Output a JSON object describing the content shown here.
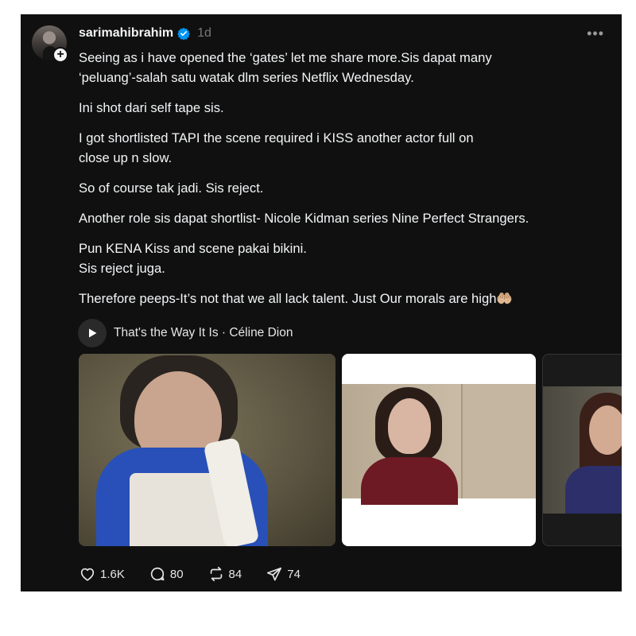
{
  "post": {
    "username": "sarimahibrahim",
    "timestamp": "1d",
    "more_label": "•••",
    "follow_badge": "+",
    "paragraphs": [
      [
        "Seeing as i have opened the ‘gates’ let me share more.Sis dapat many",
        "‘peluang’-salah satu watak dlm series Netflix Wednesday."
      ],
      [
        "Ini shot dari self tape sis."
      ],
      [
        "I got shortlisted TAPI the scene required i KISS another actor full on",
        "close up n slow."
      ],
      [
        "So of course tak jadi. Sis reject."
      ],
      [
        "Another role sis dapat shortlist- Nicole Kidman series Nine Perfect Strangers."
      ],
      [
        "Pun KENA Kiss and scene pakai bikini.",
        "Sis reject juga."
      ],
      [
        "Therefore peeps-It’s not that we all lack talent. Just Our morals are high🤲🏼"
      ]
    ],
    "music": "That's the Way It Is · Céline Dion",
    "stats": {
      "likes": "1.6K",
      "comments": "80",
      "reposts": "84",
      "shares": "74"
    },
    "colors": {
      "background": "#101010",
      "text": "#f3f5f7",
      "muted": "#777777",
      "verified": "#0095f6"
    }
  },
  "icons": {
    "verified": "verified-badge-icon",
    "play": "play-icon",
    "like": "heart-icon",
    "comment": "comment-bubble-icon",
    "repost": "repost-icon",
    "share": "send-icon",
    "more": "more-dots-icon"
  }
}
